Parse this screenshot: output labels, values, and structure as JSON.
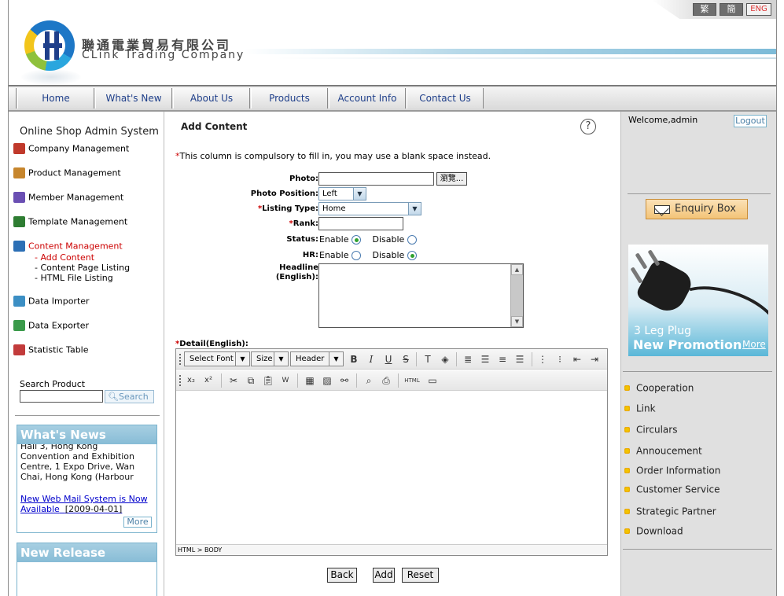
{
  "header": {
    "company_cn": "聯通電業貿易有限公司",
    "company_en": "CLink Trading Company",
    "lang": {
      "traditional": "繁",
      "simplified": "簡",
      "english": "ENG"
    }
  },
  "nav": [
    "Home",
    "What's New",
    "About Us",
    "Products",
    "Account Info",
    "Contact Us"
  ],
  "left": {
    "title": "Online Shop Admin System",
    "menu": [
      {
        "label": "Company Management",
        "icon": "company-icon",
        "color": "#c0392b"
      },
      {
        "label": "Product Management",
        "icon": "product-icon",
        "color": "#c7862d"
      },
      {
        "label": "Member Management",
        "icon": "member-icon",
        "color": "#6a4fb3"
      },
      {
        "label": "Template Management",
        "icon": "template-icon",
        "color": "#2e7d32"
      },
      {
        "label": "Content Management",
        "icon": "content-icon",
        "color": "#2c6fb5"
      },
      {
        "label": "Data Importer",
        "icon": "importer-icon",
        "color": "#3c8fc4"
      },
      {
        "label": "Data Exporter",
        "icon": "exporter-icon",
        "color": "#3a9a4a"
      },
      {
        "label": "Statistic Table",
        "icon": "chart-icon",
        "color": "#c23b3b"
      }
    ],
    "submenu": [
      "- Add Content",
      "- Content Page Listing",
      "- HTML File Listing"
    ],
    "search": {
      "label": "Search Product",
      "button": "Search"
    },
    "whats_news": {
      "title": "What's News",
      "lines": [
        "Hall 3, Hong Kong",
        "Convention and Exhibition",
        "Centre, 1 Expo Drive, Wan",
        "Chai, Hong Kong (Harbour"
      ],
      "link_1": "New Web Mail System is Now",
      "link_2": "Available",
      "date": "[2009-04-01]",
      "more": "More"
    },
    "new_release": {
      "title": "New Release"
    }
  },
  "main": {
    "title": "Add Content",
    "help": "?",
    "note_star": "*",
    "note": "This column is compulsory to fill in, you may use a blank space instead.",
    "photo_label": "Photo:",
    "browse": "瀏覽...",
    "photo_position_label": "Photo Position:",
    "photo_position_value": "Left",
    "listing_type_label": "Listing Type:",
    "listing_type_value": "Home",
    "rank_label": "Rank:",
    "status_label": "Status:",
    "hr_label": "HR:",
    "enable": "Enable",
    "disable": "Disable",
    "headline_label_1": "Headline",
    "headline_label_2": "(English):",
    "detail_label": "Detail(English):",
    "toolbar": {
      "font": "Select Font",
      "size": "Size",
      "header": "Header",
      "html": "HTML"
    },
    "status_path": "HTML > BODY",
    "buttons": {
      "back": "Back",
      "add": "Add",
      "reset": "Reset"
    }
  },
  "right": {
    "welcome": "Welcome,admin",
    "logout": "Logout",
    "enquiry": "Enquiry Box",
    "promo": {
      "line1": "3 Leg Plug",
      "line2": "New Promotion",
      "more": "More"
    },
    "links": [
      "Cooperation",
      "Link",
      "Circulars",
      "Annoucement",
      "Order Information",
      "Customer Service",
      "Strategic Partner",
      "Download"
    ]
  }
}
